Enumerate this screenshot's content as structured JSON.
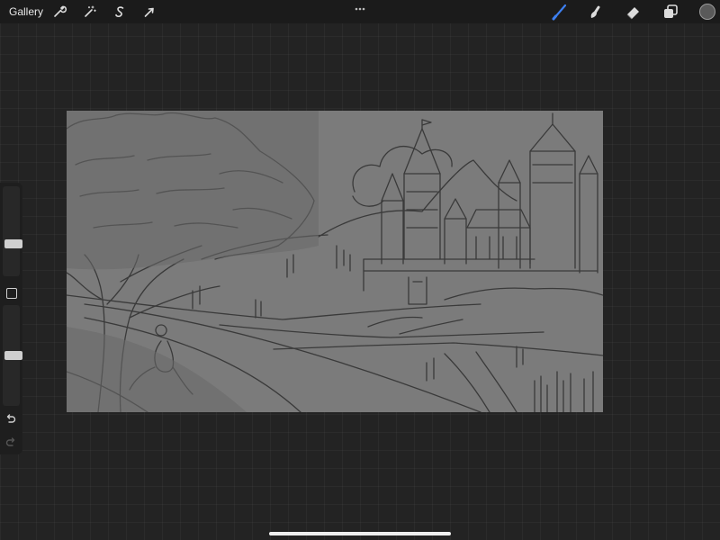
{
  "topbar": {
    "gallery_label": "Gallery",
    "left_tools": [
      {
        "name": "actions",
        "icon": "wrench-icon"
      },
      {
        "name": "adjustments",
        "icon": "magic-wand-icon"
      },
      {
        "name": "selection",
        "icon": "selection-s-icon"
      },
      {
        "name": "transform",
        "icon": "arrow-cursor-icon"
      }
    ],
    "more_icon": "ellipsis-icon",
    "right_tools": [
      {
        "name": "brush",
        "icon": "brush-icon",
        "active": true
      },
      {
        "name": "smudge",
        "icon": "smudge-icon"
      },
      {
        "name": "eraser",
        "icon": "eraser-icon"
      },
      {
        "name": "layers",
        "icon": "layers-icon"
      }
    ],
    "current_color": "#5a5a5a",
    "accent_color": "#3d7ff0"
  },
  "sidebar": {
    "brush_size_level": 0.35,
    "opacity_level": 0.5,
    "undo_icon": "undo-icon",
    "redo_icon": "redo-icon"
  },
  "canvas": {
    "background_color": "#7b7b7b",
    "line_color": "#3a3a3a",
    "subject": "castle-landscape-sketch"
  }
}
